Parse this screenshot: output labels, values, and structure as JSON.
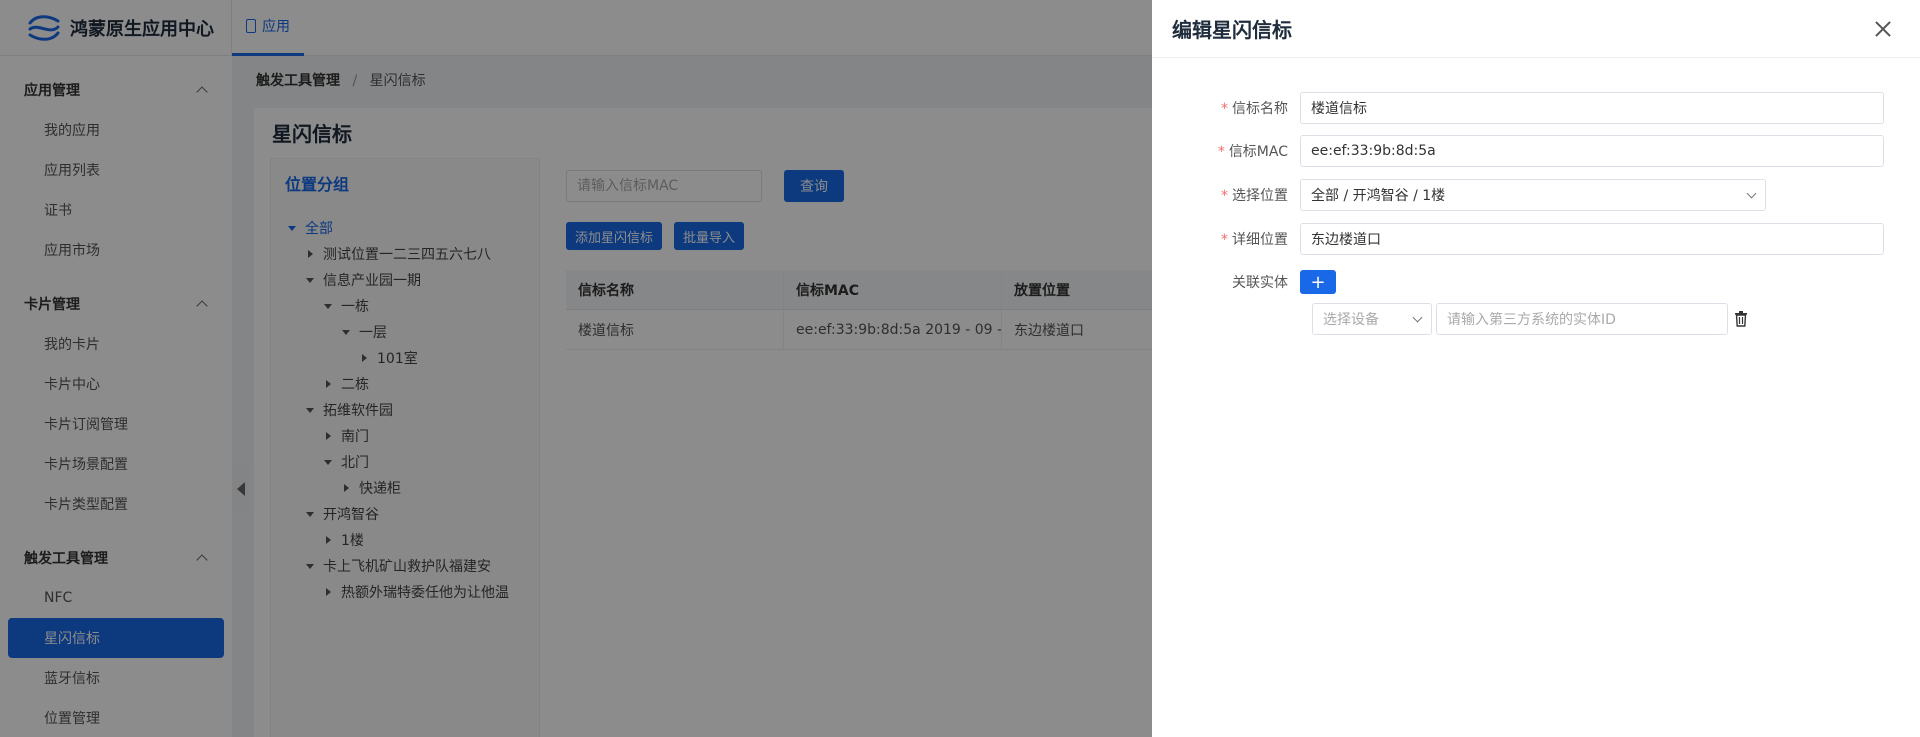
{
  "app": {
    "title": "鸿蒙原生应用中心",
    "nav_tab": "应用"
  },
  "sidebar": {
    "groups": [
      {
        "label": "应用管理",
        "items": [
          "我的应用",
          "应用列表",
          "证书",
          "应用市场"
        ]
      },
      {
        "label": "卡片管理",
        "items": [
          "我的卡片",
          "卡片中心",
          "卡片订阅管理",
          "卡片场景配置",
          "卡片类型配置"
        ]
      },
      {
        "label": "触发工具管理",
        "items": [
          "NFC",
          "星闪信标",
          "蓝牙信标",
          "位置管理"
        ]
      }
    ],
    "active_item": "星闪信标"
  },
  "breadcrumb": {
    "parent": "触发工具管理",
    "separator": "/",
    "current": "星闪信标"
  },
  "page": {
    "title": "星闪信标",
    "group_panel_title": "位置分组",
    "tree": [
      {
        "label": "全部",
        "level": 0,
        "state": "open"
      },
      {
        "label": "测试位置一二三四五六七八",
        "level": 1,
        "state": "closed"
      },
      {
        "label": "信息产业园一期",
        "level": 1,
        "state": "open"
      },
      {
        "label": "一栋",
        "level": 2,
        "state": "open"
      },
      {
        "label": "一层",
        "level": 3,
        "state": "open"
      },
      {
        "label": "101室",
        "level": 4,
        "state": "closed"
      },
      {
        "label": "二栋",
        "level": 2,
        "state": "closed"
      },
      {
        "label": "拓维软件园",
        "level": 1,
        "state": "open"
      },
      {
        "label": "南门",
        "level": 2,
        "state": "closed"
      },
      {
        "label": "北门",
        "level": 2,
        "state": "open"
      },
      {
        "label": "快递柜",
        "level": 3,
        "state": "closed"
      },
      {
        "label": "开鸿智谷",
        "level": 1,
        "state": "open"
      },
      {
        "label": "1楼",
        "level": 2,
        "state": "closed"
      },
      {
        "label": "卡上飞机矿山救护队福建安",
        "level": 1,
        "state": "open"
      },
      {
        "label": "热额外瑞特委任他为让他温",
        "level": 2,
        "state": "closed"
      }
    ],
    "search_placeholder": "请输入信标MAC",
    "query_button": "查询",
    "add_button": "添加星闪信标",
    "import_button": "批量导入",
    "table": {
      "columns": [
        "信标名称",
        "信标MAC",
        "放置位置"
      ],
      "rows": [
        {
          "name": "楼道信标",
          "mac": "ee:ef:33:9b:8d:5a  2019 - 09 -...",
          "location": "东边楼道口"
        }
      ]
    }
  },
  "drawer": {
    "title": "编辑星闪信标",
    "fields": {
      "name": {
        "label": "信标名称",
        "value": "楼道信标"
      },
      "mac": {
        "label": "信标MAC",
        "value": "ee:ef:33:9b:8d:5a"
      },
      "location": {
        "label": "选择位置",
        "value": "全部 / 开鸿智谷 / 1楼"
      },
      "detail": {
        "label": "详细位置",
        "value": "东边楼道口"
      },
      "entity": {
        "label": "关联实体",
        "add_label": "+",
        "device_placeholder": "选择设备",
        "id_placeholder": "请输入第三方系统的实体ID"
      }
    }
  },
  "colors": {
    "primary": "#1868e8",
    "required": "#f56c6c"
  }
}
